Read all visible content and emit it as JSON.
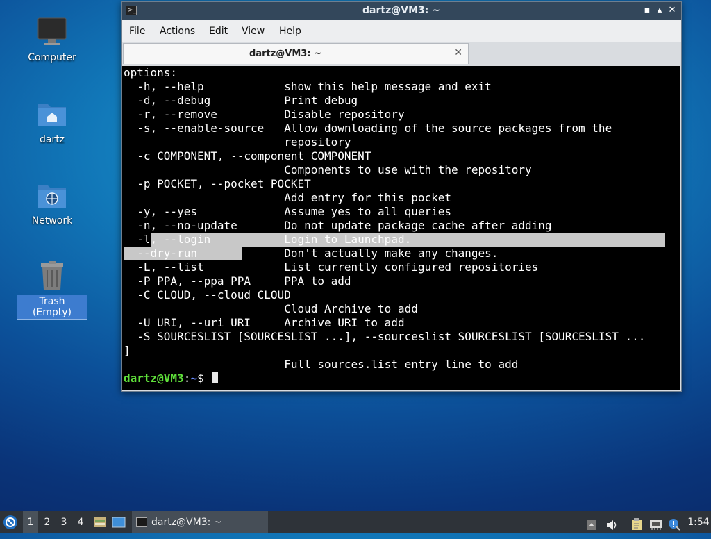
{
  "desktop": {
    "icons": [
      {
        "label": "Computer"
      },
      {
        "label": "dartz"
      },
      {
        "label": "Network"
      },
      {
        "label": "Trash (Empty)"
      }
    ]
  },
  "window": {
    "title": "dartz@VM3: ~",
    "controls": {
      "minimize": "▪",
      "maximize": "▴",
      "close": "✕"
    },
    "menu": [
      "File",
      "Actions",
      "Edit",
      "View",
      "Help"
    ],
    "tab": {
      "title": "dartz@VM3: ~",
      "close": "✕"
    }
  },
  "terminal": {
    "lines": [
      "options:",
      "  -h, --help            show this help message and exit",
      "  -d, --debug           Print debug",
      "  -r, --remove          Disable repository",
      "  -s, --enable-source   Allow downloading of the source packages from the",
      "                        repository",
      "  -c COMPONENT, --component COMPONENT",
      "                        Components to use with the repository",
      "  -p POCKET, --pocket POCKET",
      "                        Add entry for this pocket",
      "  -y, --yes             Assume yes to all queries",
      "  -n, --no-update       Do not update package cache after adding",
      "  -l, --login           Login to Launchpad.",
      "  --dry-run             Don't actually make any changes.",
      "  -L, --list            List currently configured repositories",
      "  -P PPA, --ppa PPA     PPA to add",
      "  -C CLOUD, --cloud CLOUD",
      "                        Cloud Archive to add",
      "  -U URI, --uri URI     Archive URI to add",
      "  -S SOURCESLIST [SOURCESLIST ...], --sourceslist SOURCESLIST [SOURCESLIST ...",
      "]",
      "                        Full sources.list entry line to add"
    ],
    "prompt": {
      "user_host": "dartz@VM3",
      "sep": ":",
      "path": "~",
      "symbol": "$ "
    }
  },
  "taskbar": {
    "workspaces": [
      "1",
      "2",
      "3",
      "4"
    ],
    "active_workspace": "1",
    "task_label": "dartz@VM3: ~",
    "clock": "1:54"
  },
  "colors": {
    "prompt_user": "#5fe03a",
    "prompt_path": "#6a8cff",
    "selection": "#c8c8c8",
    "titlebar": "#33475b"
  }
}
